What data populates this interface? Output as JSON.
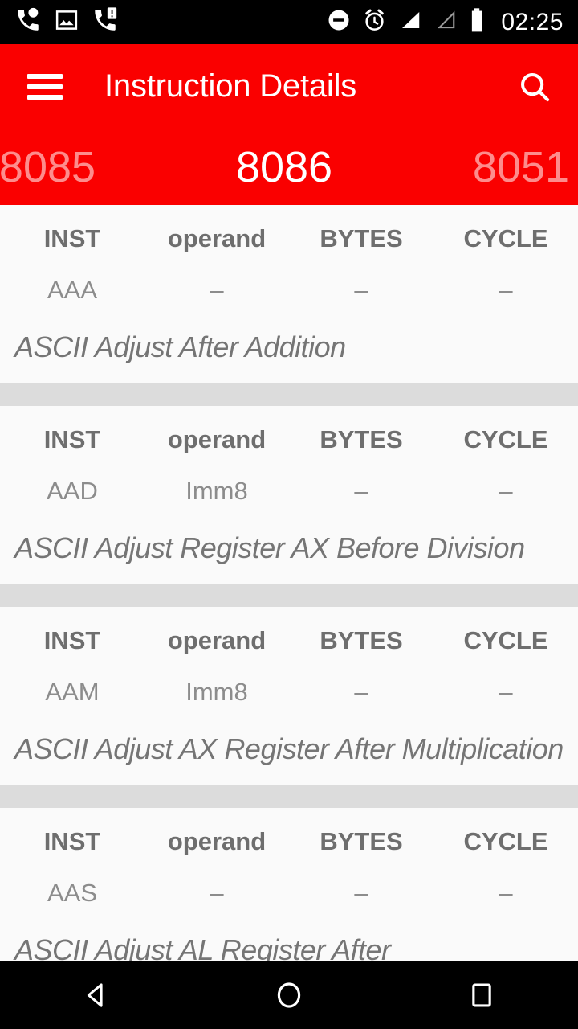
{
  "status_bar": {
    "time": "02:25",
    "left_icons": [
      "missed-call-icon",
      "image-icon",
      "call-alert-icon"
    ],
    "right_icons": [
      "do-not-disturb-icon",
      "alarm-icon",
      "signal-full-icon",
      "signal-empty-icon",
      "battery-icon"
    ]
  },
  "toolbar": {
    "menu_icon": "hamburger-menu-icon",
    "title": "Instruction Details",
    "search_icon": "search-icon",
    "background_color": "#fa0000"
  },
  "tabs": {
    "items": [
      {
        "label": "8085",
        "selected": false
      },
      {
        "label": "8086",
        "selected": true
      },
      {
        "label": "8051",
        "selected": false
      }
    ]
  },
  "table": {
    "headers": [
      "INST",
      "operand",
      "BYTES",
      "CYCLE"
    ]
  },
  "instructions": [
    {
      "inst": "AAA",
      "operand": "–",
      "bytes": "–",
      "cycle": "–",
      "description": "ASCII Adjust After Addition"
    },
    {
      "inst": "AAD",
      "operand": "Imm8",
      "bytes": "–",
      "cycle": "–",
      "description": "ASCII Adjust Register AX Before Division"
    },
    {
      "inst": "AAM",
      "operand": "Imm8",
      "bytes": "–",
      "cycle": "–",
      "description": "ASCII Adjust AX Register After Multiplication"
    },
    {
      "inst": "AAS",
      "operand": "–",
      "bytes": "–",
      "cycle": "–",
      "description": "ASCII Adjust AL Register After"
    }
  ],
  "nav_bar": {
    "back_icon": "back-triangle-icon",
    "home_icon": "home-circle-icon",
    "recents_icon": "recents-square-icon"
  }
}
